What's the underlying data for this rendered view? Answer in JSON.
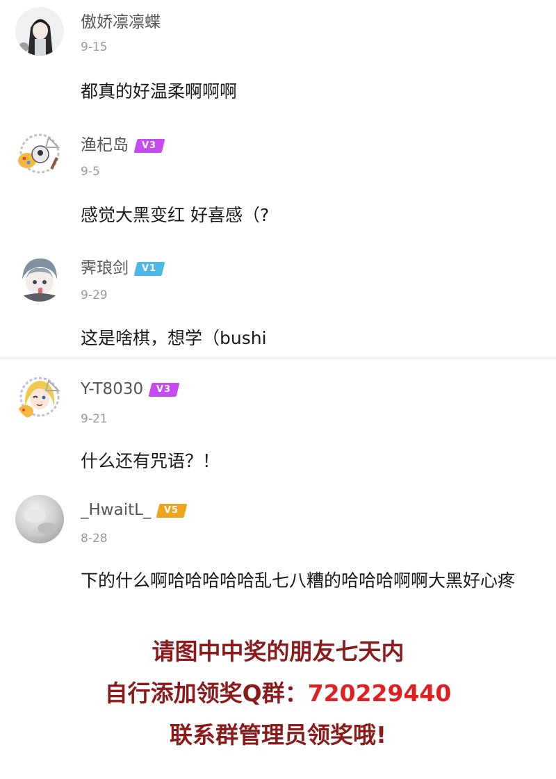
{
  "comments": [
    {
      "username": "傲娇凛凛蝶",
      "badge": "",
      "date": "9-15",
      "text": "都真的好温柔啊啊啊"
    },
    {
      "username": "渔杞岛",
      "badge": "V3",
      "badge_color": "#c54cf0",
      "date": "9-5",
      "text": "感觉大黑变红 好喜感（?"
    },
    {
      "username": "霁琅剑",
      "badge": "V1",
      "badge_color": "#4db8e8",
      "date": "9-29",
      "text": "这是啥棋，想学（bushi"
    },
    {
      "username": "Y-T8030",
      "badge": "V3",
      "badge_color": "#c54cf0",
      "date": "9-21",
      "text": "什么还有咒语？！"
    },
    {
      "username": "_HwaitL_",
      "badge": "V5",
      "badge_color": "#f0a41e",
      "date": "8-28",
      "text": "下的什么啊哈哈哈哈哈乱七八糟的哈哈哈啊啊大黑好心疼"
    }
  ],
  "notice": {
    "line1": "请图中中奖的朋友七天内",
    "line2_prefix": "自行添加领奖Q群：",
    "line2_number": "720229440",
    "line3": "联系群管理员领奖哦!",
    "color": "#8b1a1a",
    "number_color": "#e02020"
  },
  "icons": {
    "avatar_1": "anime-girl-avatar",
    "avatar_2": "art-palette-avatar",
    "avatar_3": "chibi-swordsman-avatar",
    "avatar_4": "blonde-girl-palette-avatar",
    "avatar_5": "grey-cloud-avatar"
  }
}
